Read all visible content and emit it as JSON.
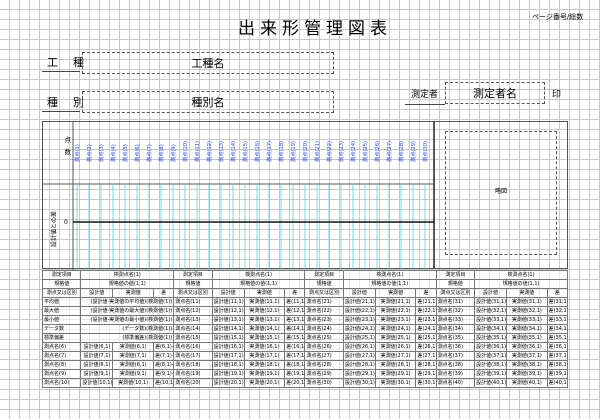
{
  "header": {
    "title": "出来形管理図表",
    "page_label": "ページ番号/総数"
  },
  "fields": {
    "koshu_label": "工　種",
    "koshu_value": "工種名",
    "shubetsu_label": "種　別",
    "shubetsu_value": "種別名",
    "sokuteisha_label": "測定者",
    "sokuteisha_value": "測定者名",
    "in_label": "印"
  },
  "chart_data": {
    "type": "line",
    "y_label_points": "点数",
    "y_label_axis": "設計値との差",
    "zero_tick": "0",
    "x_labels": [
      "測点(1)",
      "測点(2)",
      "測点(3)",
      "測点(4)",
      "測点(5)",
      "測点(6)",
      "測点(7)",
      "測点(8)",
      "測点(9)",
      "測点(10)",
      "測点(11)",
      "測点(12)",
      "測点(13)",
      "測点(14)",
      "測点(15)",
      "測点(16)",
      "測点(17)",
      "測点(18)",
      "測点(19)",
      "測点(20)",
      "測点(21)",
      "測点(22)",
      "測点(23)",
      "測点(24)",
      "測点(25)",
      "測点(26)",
      "測点(27)",
      "測点(28)",
      "測点(29)",
      "測点(30)"
    ],
    "grid": true,
    "accent_color": "#4fc6d8",
    "label_color": "#2244cc"
  },
  "sketch": {
    "label": "略図"
  },
  "table": {
    "blocks": [
      {
        "header1": [
          "測定項目",
          "検測点名(1)"
        ],
        "header2": [
          "規格値",
          "規格値の値(1,1)"
        ],
        "header3": [
          "測点又は区別",
          "設計値",
          "実測値",
          "差"
        ],
        "rows": [
          [
            "測点名(1)",
            "設計値(1,1)",
            "実測値(1,1)",
            "差(1,1)-1"
          ],
          [
            "測点名(2)",
            "設計値(2,1)",
            "実測値(2,1)",
            "差(2,1)-1"
          ],
          [
            "測点名(3)",
            "設計値(3,1)",
            "実測値(3,1)",
            "差(3,1)-1"
          ],
          [
            "測点名(4)",
            "設計値(4,1)",
            "実測値(4,1)",
            "差(4,1)-1"
          ],
          [
            "測点名(5)",
            "設計値(5,1)",
            "実測値(5,1)",
            "差(5,1)-1"
          ],
          [
            "測点名(6)",
            "設計値(6,1)",
            "実測値(6,1)",
            "差(6,1)-1"
          ],
          [
            "測点名(7)",
            "設計値(7,1)",
            "実測値(7,1)",
            "差(7,1)-1"
          ],
          [
            "測点名(8)",
            "設計値(8,1)",
            "実測値(8,1)",
            "差(8,1)-1"
          ],
          [
            "測点名(9)",
            "設計値(9,1)",
            "実測値(9,1)",
            "差(9,1)-1"
          ],
          [
            "測点名(10)",
            "設計値(10,1)",
            "実測値(10,1)",
            "差(10,1)-1"
          ]
        ]
      },
      {
        "header1": [
          "測定項目",
          "検測点名(1)"
        ],
        "header2": [
          "規格値",
          "規格値の値(1,1)"
        ],
        "header3": [
          "測点又は区別",
          "設計値",
          "実測値",
          "差"
        ],
        "rows": [
          [
            "測点名(11)",
            "設計値(11,1)",
            "実測値(11,1)",
            "差(11,1)-1"
          ],
          [
            "測点名(12)",
            "設計値(12,1)",
            "実測値(12,1)",
            "差(12,1)-1"
          ],
          [
            "測点名(13)",
            "設計値(13,1)",
            "実測値(13,1)",
            "差(13,1)-1"
          ],
          [
            "測点名(14)",
            "設計値(14,1)",
            "実測値(14,1)",
            "差(14,1)-1"
          ],
          [
            "測点名(15)",
            "設計値(15,1)",
            "実測値(15,1)",
            "差(15,1)-1"
          ],
          [
            "測点名(16)",
            "設計値(16,1)",
            "実測値(16,1)",
            "差(16,1)-1"
          ],
          [
            "測点名(17)",
            "設計値(17,1)",
            "実測値(17,1)",
            "差(17,1)-1"
          ],
          [
            "測点名(18)",
            "設計値(18,1)",
            "実測値(18,1)",
            "差(18,1)-1"
          ],
          [
            "測点名(19)",
            "設計値(19,1)",
            "実測値(19,1)",
            "差(19,1)-1"
          ],
          [
            "測点名(20)",
            "設計値(20,1)",
            "実測値(20,1)",
            "差(20,1)-1"
          ]
        ]
      },
      {
        "header1": [
          "測定項目",
          "検測点名(1)"
        ],
        "header2": [
          "規格値",
          "規格値の値(1,1)"
        ],
        "header3": [
          "測点又は区別",
          "設計値",
          "実測値",
          "差"
        ],
        "rows": [
          [
            "測点名(21)",
            "設計値(21,1)",
            "実測値(21,1)",
            "差(21,1)-1"
          ],
          [
            "測点名(22)",
            "設計値(22,1)",
            "実測値(22,1)",
            "差(22,1)-1"
          ],
          [
            "測点名(23)",
            "設計値(23,1)",
            "実測値(23,1)",
            "差(23,1)-1"
          ],
          [
            "測点名(24)",
            "設計値(24,1)",
            "実測値(24,1)",
            "差(24,1)-1"
          ],
          [
            "測点名(25)",
            "設計値(25,1)",
            "実測値(25,1)",
            "差(25,1)-1"
          ],
          [
            "測点名(26)",
            "設計値(26,1)",
            "実測値(26,1)",
            "差(26,1)-1"
          ],
          [
            "測点名(27)",
            "設計値(27,1)",
            "実測値(27,1)",
            "差(27,1)-1"
          ],
          [
            "測点名(28)",
            "設計値(28,1)",
            "実測値(28,1)",
            "差(28,1)-1"
          ],
          [
            "測点名(29)",
            "設計値(29,1)",
            "実測値(29,1)",
            "差(29,1)-1"
          ],
          [
            "測点名(30)",
            "設計値(30,1)",
            "実測値(30,1)",
            "差(30,1)-1"
          ]
        ]
      },
      {
        "header1": [
          "測定項目",
          "検測点名(1)"
        ],
        "header2": [
          "規格値",
          "規格値の値(1,1)"
        ],
        "header3": [
          "測点又は区別",
          "設計値",
          "実測値",
          "差"
        ],
        "rows": [
          [
            "測点名(31)",
            "設計値(31,1)",
            "実測値(31,1)",
            "差(31,1)-1"
          ],
          [
            "測点名(32)",
            "設計値(32,1)",
            "実測値(32,1)",
            "差(32,1)-1"
          ],
          [
            "測点名(33)",
            "設計値(33,1)",
            "実測値(33,1)",
            "差(33,1)-1"
          ],
          [
            "測点名(34)",
            "設計値(34,1)",
            "実測値(34,1)",
            "差(34,1)-1"
          ],
          [
            "測点名(35)",
            "設計値(35,1)",
            "実測値(35,1)",
            "差(35,1)-1"
          ],
          [
            "測点名(36)",
            "設計値(36,1)",
            "実測値(36,1)",
            "差(36,1)-1"
          ],
          [
            "測点名(37)",
            "設計値(37,1)",
            "実測値(37,1)",
            "差(37,1)-1"
          ],
          [
            "測点名(38)",
            "設計値(38,1)",
            "実測値(38,1)",
            "差(38,1)-1"
          ],
          [
            "測点名(39)",
            "設計値(39,1)",
            "実測値(39,1)",
            "差(39,1)-1"
          ],
          [
            "測点名(40)",
            "設計値(40,1)",
            "実測値(40,1)",
            "差(40,1)-1"
          ]
        ]
      }
    ],
    "stats": [
      {
        "label": "平均値",
        "value": "(設計値-実測値の平均値)(検測値(1))"
      },
      {
        "label": "最大値",
        "value": "(設計値-実測値の最大値)(検測値(1))"
      },
      {
        "label": "最小値",
        "value": "(設計値-実測値の最小値)(検測値(1))"
      },
      {
        "label": "データ数",
        "value": "(データ数)(検測値(1))"
      },
      {
        "label": "標準偏差",
        "value": "(標準偏差)(検測値(1))"
      }
    ]
  }
}
